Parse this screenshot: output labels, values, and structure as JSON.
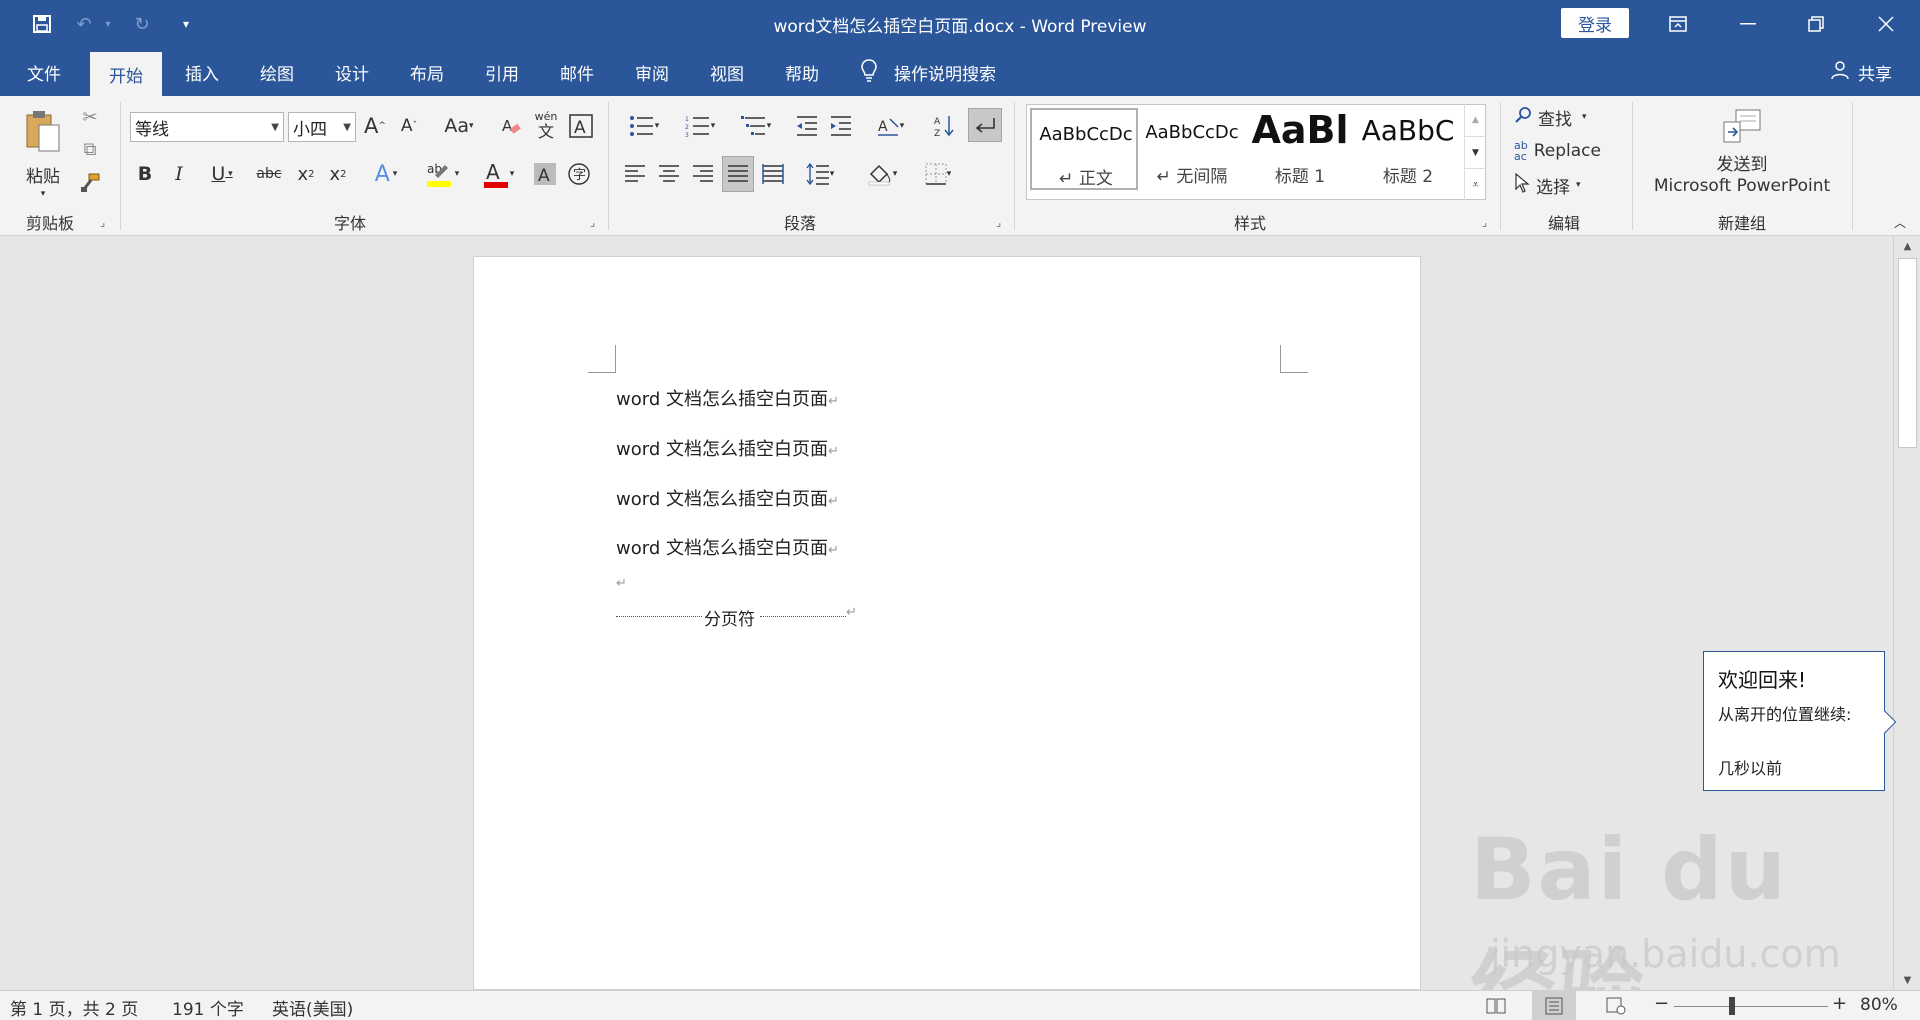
{
  "titlebar": {
    "title": "word文档怎么插空白页面.docx  -  Word Preview",
    "login": "登录",
    "save_icon": "save-icon",
    "undo_icon": "undo-icon",
    "redo_icon": "redo-icon",
    "customize_icon": "customize-quick-access-icon"
  },
  "tabs": [
    {
      "label": "文件"
    },
    {
      "label": "开始"
    },
    {
      "label": "插入"
    },
    {
      "label": "绘图"
    },
    {
      "label": "设计"
    },
    {
      "label": "布局"
    },
    {
      "label": "引用"
    },
    {
      "label": "邮件"
    },
    {
      "label": "审阅"
    },
    {
      "label": "视图"
    },
    {
      "label": "帮助"
    }
  ],
  "search_tab": "操作说明搜索",
  "share": "共享",
  "ribbon": {
    "clipboard": {
      "label": "剪贴板",
      "paste": "粘贴"
    },
    "font": {
      "label": "字体",
      "font_name": "等线",
      "font_size": "小四"
    },
    "paragraph": {
      "label": "段落"
    },
    "styles": {
      "label": "样式",
      "items": [
        {
          "preview": "AaBbCcDc",
          "name": "↵ 正文"
        },
        {
          "preview": "AaBbCcDc",
          "name": "↵ 无间隔"
        },
        {
          "preview": "AaBl",
          "name": "标题 1"
        },
        {
          "preview": "AaBbC",
          "name": "标题 2"
        }
      ]
    },
    "editing": {
      "label": "编辑",
      "find": "查找",
      "replace": "Replace",
      "select": "选择"
    },
    "newgroup": {
      "label": "新建组",
      "send_line1": "发送到",
      "send_line2": "Microsoft PowerPoint"
    }
  },
  "document": {
    "paragraphs": [
      "word 文档怎么插空白页面",
      "word 文档怎么插空白页面",
      "word 文档怎么插空白页面",
      "word 文档怎么插空白页面"
    ],
    "page_break": "分页符"
  },
  "welcome": {
    "title": "欢迎回来!",
    "subtitle": "从离开的位置继续:",
    "time": "几秒以前"
  },
  "statusbar": {
    "page": "第 1 页，共 2 页",
    "words": "191 个字",
    "language": "英语(美国)",
    "zoom": "80%"
  },
  "watermark": {
    "brand": "Bai du 经验",
    "url": "jingyan.baidu.com"
  }
}
